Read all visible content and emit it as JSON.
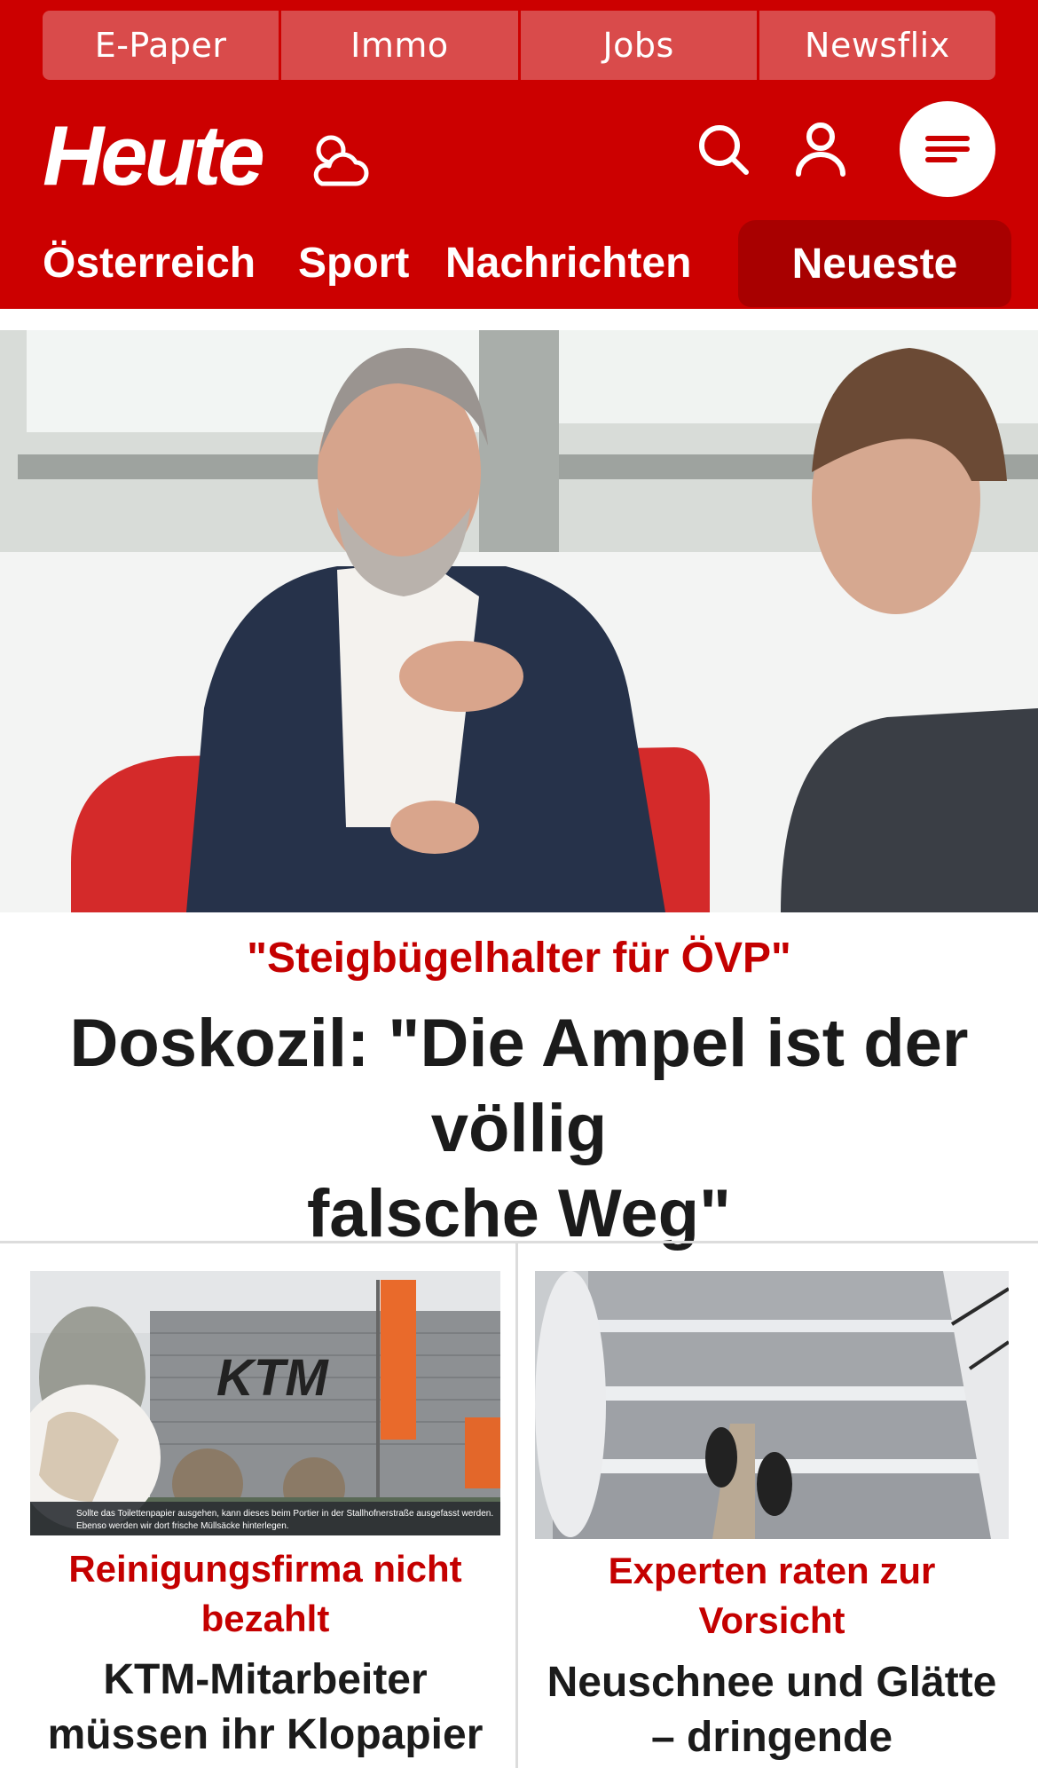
{
  "topnav": {
    "items": [
      "E-Paper",
      "Immo",
      "Jobs",
      "Newsflix"
    ]
  },
  "header": {
    "logo_text": "Heute"
  },
  "colors": {
    "brand_red": "#cc0000",
    "dark_red": "#a80000",
    "kicker_red": "#c40000"
  },
  "icons": {
    "weather": "weather-icon",
    "search": "search-icon",
    "user": "user-icon",
    "menu": "menu-icon"
  },
  "secnav": {
    "items": [
      "Österreich",
      "Sport",
      "Nachrichten"
    ],
    "active": "Neueste"
  },
  "hero": {
    "kicker": "\"Steigbügelhalter für ÖVP\"",
    "title_line1": "Doskozil: \"Die Ampel ist der völlig",
    "title_line2": "falsche Weg\""
  },
  "cards": [
    {
      "kicker_line1": "Reinigungsfirma nicht",
      "kicker_line2": "bezahlt",
      "title_line1": "KTM-Mitarbeiter",
      "title_line2": "müssen ihr Klopapier",
      "image_caption_line1": "Sollte das Toilettenpapier ausgehen, kann dieses beim Portier in der Stallhofnerstraße ausgefasst werden.",
      "image_caption_line2": "Ebenso werden wir dort frische Müllsäcke hinterlegen.",
      "image_logo": "KTM"
    },
    {
      "kicker_line1": "Experten raten zur",
      "kicker_line2": "Vorsicht",
      "title_line1": "Neuschnee und Glätte",
      "title_line2": "– dringende"
    }
  ]
}
